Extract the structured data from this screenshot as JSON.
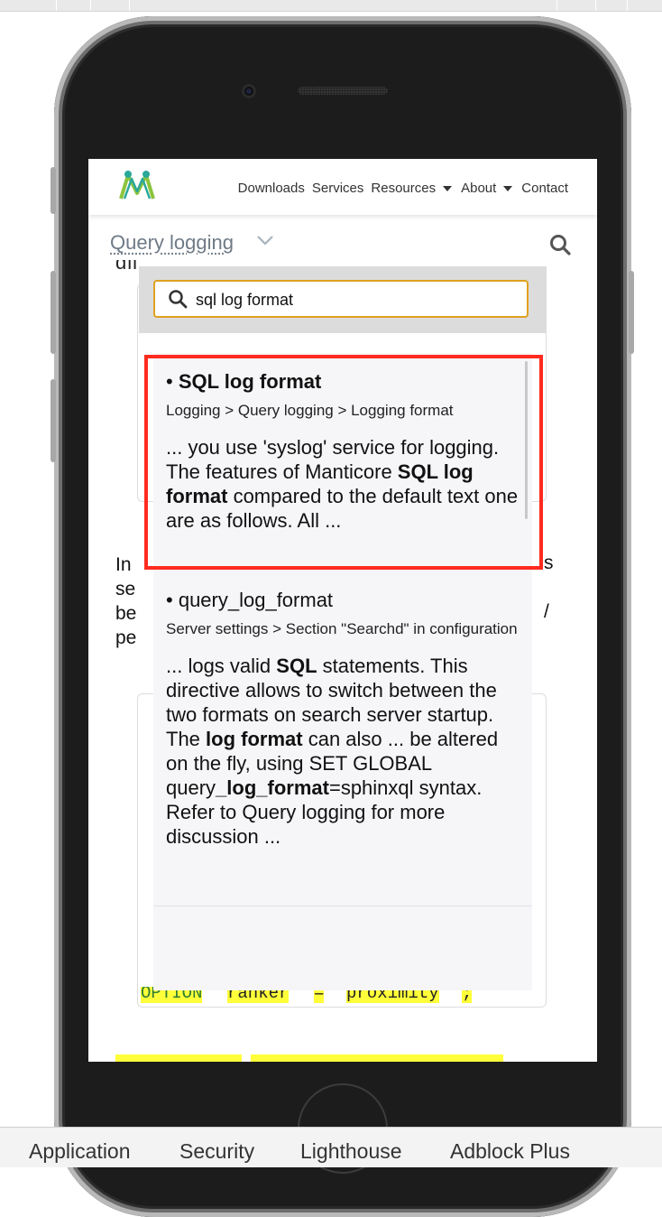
{
  "site": {
    "nav": {
      "downloads": "Downloads",
      "services": "Services",
      "resources": "Resources",
      "about": "About",
      "contact": "Contact"
    },
    "page_title": "Query logging"
  },
  "background_text": {
    "para_lines": [
      "In",
      "se",
      "be",
      "pe"
    ],
    "para_right_1": "s",
    "para_right_2": "/",
    "code_fragments": [
      "OPTION",
      "ranker",
      "=",
      "proximity",
      ";"
    ]
  },
  "search": {
    "query": "sql log format",
    "results": [
      {
        "bullet": "•",
        "title": "SQL log format",
        "path": "Logging > Query logging > Logging format",
        "snippet_parts": [
          {
            "text": "... you use 'syslog' service for logging. The features of Manticore ",
            "bold": false
          },
          {
            "text": "SQL log format",
            "bold": true
          },
          {
            "text": " compared to the default text one are as follows. All ...",
            "bold": false
          }
        ]
      },
      {
        "bullet": "•",
        "title": "query_log_format",
        "path": "Server settings > Section \"Searchd\" in configuration",
        "snippet_parts": [
          {
            "text": "... logs valid ",
            "bold": false
          },
          {
            "text": "SQL",
            "bold": true
          },
          {
            "text": " statements. This directive allows to switch between the two formats on search server startup. The ",
            "bold": false
          },
          {
            "text": "log format",
            "bold": true
          },
          {
            "text": " can also ... be altered on the fly, using SET GLOBAL query",
            "bold": false
          },
          {
            "text": "_log_format",
            "bold": true
          },
          {
            "text": "=sphinxql syntax. Refer to Query logging for more discussion ...",
            "bold": false
          }
        ]
      }
    ]
  },
  "devtools": {
    "tabs": [
      "Application",
      "Security",
      "Lighthouse",
      "Adblock Plus"
    ]
  },
  "colors": {
    "highlight_border": "#ff2b1e",
    "search_focus": "#e0a020",
    "logo_green": "#8cc43c",
    "logo_teal": "#2aa89a",
    "text_highlight": "#ffff3a"
  },
  "icons": {
    "logo": "manticore-logo-icon",
    "search": "search-icon",
    "chevron": "chevron-down-icon"
  }
}
